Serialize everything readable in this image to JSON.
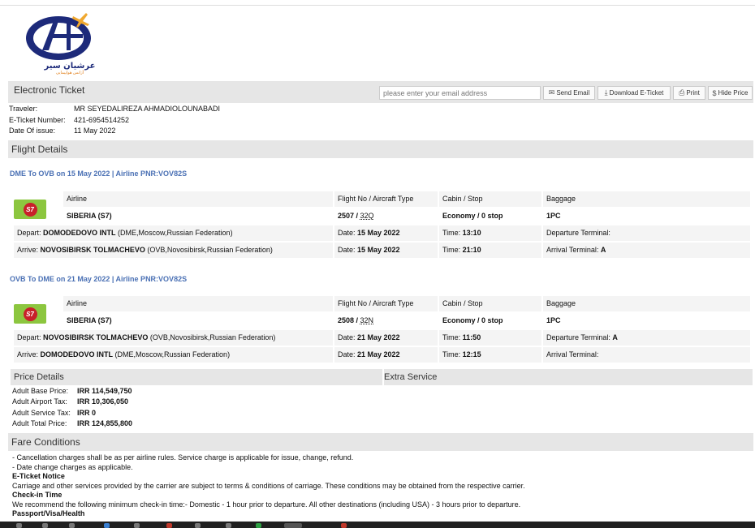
{
  "brand": {
    "name_fa": "عرشیان سیر",
    "tagline_fa": "آژانس هواپیمایی",
    "colors": {
      "primary": "#1d2a7a",
      "accent": "#f0a830"
    }
  },
  "header": {
    "title": "Electronic Ticket",
    "email_placeholder": "please enter your email address",
    "buttons": {
      "send_email": "Send Email",
      "download": "Download E-Ticket",
      "print": "Print",
      "hide_price": "Hide Price"
    }
  },
  "traveler": {
    "traveler_label": "Traveler:",
    "traveler_value": "MR SEYEDALIREZA AHMADIOLOUNABADI",
    "ticket_label": "E-Ticket Number:",
    "ticket_value": "421-6954514252",
    "date_label": "Date Of issue:",
    "date_value": "11 May 2022"
  },
  "flight_details_title": "Flight Details",
  "segments": [
    {
      "title": "DME To OVB on 15 May 2022 | Airline PNR:VOV82S",
      "airline_logo_text": "S7",
      "col_airline": "Airline",
      "col_flight": "Flight No / Aircraft Type",
      "col_cabin": "Cabin / Stop",
      "col_baggage": "Baggage",
      "airline": "SIBERIA (S7)",
      "flight_no": "2507 / ",
      "aircraft": "32Q",
      "cabin": "Economy / 0 stop",
      "baggage": "1PC",
      "depart_label": "Depart: ",
      "depart_airport": "DOMODEDOVO INTL",
      "depart_detail": " (DME,Moscow,Russian Federation)",
      "depart_date_label": "Date: ",
      "depart_date": "15 May 2022",
      "depart_time_label": "Time: ",
      "depart_time": "13:10",
      "depart_terminal_label": "Departure Terminal:",
      "depart_terminal": "",
      "arrive_label": "Arrive: ",
      "arrive_airport": "NOVOSIBIRSK TOLMACHEVO",
      "arrive_detail": " (OVB,Novosibirsk,Russian Federation)",
      "arrive_date_label": "Date: ",
      "arrive_date": "15 May 2022",
      "arrive_time_label": "Time: ",
      "arrive_time": "21:10",
      "arrive_terminal_label": "Arrival Terminal: ",
      "arrive_terminal": "A"
    },
    {
      "title": "OVB To DME on 21 May 2022 | Airline PNR:VOV82S",
      "airline_logo_text": "S7",
      "col_airline": "Airline",
      "col_flight": "Flight No / Aircraft Type",
      "col_cabin": "Cabin / Stop",
      "col_baggage": "Baggage",
      "airline": "SIBERIA (S7)",
      "flight_no": "2508 / ",
      "aircraft": "32N",
      "cabin": "Economy / 0 stop",
      "baggage": "1PC",
      "depart_label": "Depart: ",
      "depart_airport": "NOVOSIBIRSK TOLMACHEVO",
      "depart_detail": " (OVB,Novosibirsk,Russian Federation)",
      "depart_date_label": "Date: ",
      "depart_date": "21 May 2022",
      "depart_time_label": "Time: ",
      "depart_time": "11:50",
      "depart_terminal_label": "Departure Terminal: ",
      "depart_terminal": "A",
      "arrive_label": "Arrive: ",
      "arrive_airport": "DOMODEDOVO INTL",
      "arrive_detail": " (DME,Moscow,Russian Federation)",
      "arrive_date_label": "Date: ",
      "arrive_date": "21 May 2022",
      "arrive_time_label": "Time: ",
      "arrive_time": "12:15",
      "arrive_terminal_label": "Arrival Terminal:",
      "arrive_terminal": ""
    }
  ],
  "price": {
    "title": "Price Details",
    "extra_title": "Extra Service",
    "rows": [
      {
        "label": "Adult Base Price:",
        "value": "IRR 114,549,750"
      },
      {
        "label": "Adult Airport Tax:",
        "value": "IRR 10,306,050"
      },
      {
        "label": "Adult Service Tax:",
        "value": "IRR 0"
      },
      {
        "label": "Adult Total Price:",
        "value": "IRR 124,855,800"
      }
    ]
  },
  "fare": {
    "title": "Fare Conditions",
    "line1": "- Cancellation charges shall be as per airline rules. Service charge is applicable for issue, change, refund.",
    "line2": "- Date change charges as applicable.",
    "eticket_heading": "E-Ticket Notice",
    "eticket_text": "Carriage and other services provided by the carrier are subject to terms & conditions of carriage. These conditions may be obtained from the respective carrier.",
    "checkin_heading": "Check-in Time",
    "checkin_text": "We recommend the following minimum check-in time:- Domestic - 1 hour prior to departure. All other destinations (including USA) - 3 hours prior to departure.",
    "passport_heading": "Passport/Visa/Health"
  }
}
